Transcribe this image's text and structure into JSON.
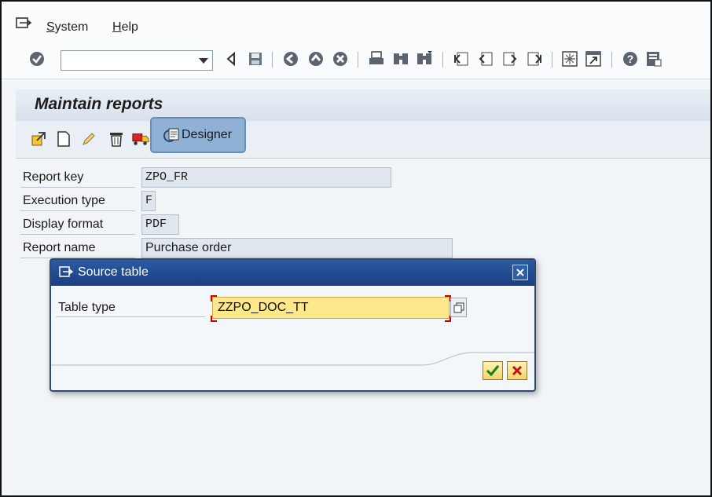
{
  "menubar": {
    "logo_icon": "sap-menu-icon",
    "items": [
      {
        "label": "System",
        "mnemonic_index": 0
      },
      {
        "label": "Help",
        "mnemonic_index": 0
      }
    ]
  },
  "toolbar": {
    "command_field": {
      "value": "",
      "placeholder": ""
    },
    "icons": [
      "enter-checkmark-icon",
      "back-triangle-icon",
      "save-icon",
      "back-icon",
      "exit-icon",
      "cancel-icon",
      "print-icon",
      "find-icon",
      "find-next-icon",
      "first-page-icon",
      "previous-page-icon",
      "next-page-icon",
      "last-page-icon",
      "new-session-icon",
      "shortcut-icon",
      "help-icon",
      "customize-layout-icon"
    ]
  },
  "screen": {
    "title": "Maintain reports",
    "app_toolbar": {
      "icons": [
        "display-change-icon",
        "create-icon",
        "edit-pencil-icon",
        "delete-icon",
        "transport-truck-icon"
      ],
      "designer_label": "Designer"
    },
    "fields": [
      {
        "label": "Report key",
        "value": "ZPO_FR"
      },
      {
        "label": "Execution type",
        "value": "F"
      },
      {
        "label": "Display format",
        "value": "PDF"
      },
      {
        "label": "Report name",
        "value": "Purchase order"
      }
    ]
  },
  "dialog": {
    "title": "Source table",
    "field_label": "Table type",
    "field_value": "ZZPO_DOC_TT",
    "accent_color": "#1f4788",
    "input_bg": "#fde98b"
  }
}
